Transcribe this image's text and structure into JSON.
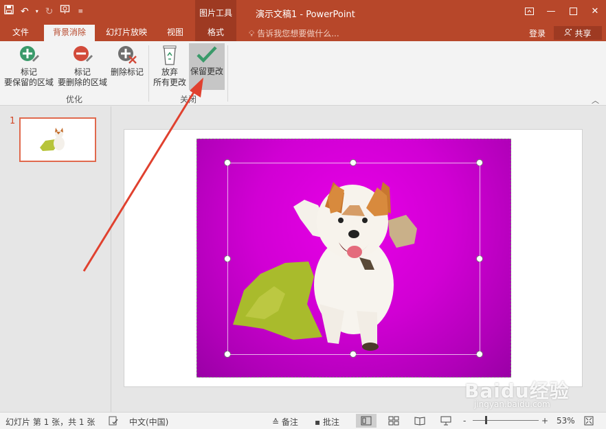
{
  "titlebar": {
    "context_tab_title": "图片工具",
    "document_title": "演示文稿1 - PowerPoint"
  },
  "tabs": [
    {
      "label": "文件"
    },
    {
      "label": "背景消除"
    },
    {
      "label": "幻灯片放映"
    },
    {
      "label": "视图"
    },
    {
      "label": "格式"
    }
  ],
  "tellme": {
    "placeholder": "告诉我您想要做什么..."
  },
  "account": {
    "login": "登录",
    "share": "共享"
  },
  "ribbon": {
    "btn_keep": {
      "line1": "标记",
      "line2": "要保留的区域"
    },
    "btn_remove": {
      "line1": "标记",
      "line2": "要删除的区域"
    },
    "btn_delete_mark": {
      "line1": "删除标记"
    },
    "group_refine": "优化",
    "btn_discard": {
      "line1": "放弃",
      "line2": "所有更改"
    },
    "btn_keep_changes": {
      "line1": "保留更改"
    },
    "group_close": "关闭"
  },
  "slides": {
    "current_number": "1"
  },
  "statusbar": {
    "slide_info": "幻灯片 第 1 张，共 1 张",
    "language": "中文(中国)",
    "notes": "备注",
    "comments": "批注",
    "zoom_minus": "-",
    "zoom_plus": "+",
    "zoom_level": "53%"
  },
  "watermark": {
    "brand": "Baidu经验",
    "url": "jingyan.baidu.com"
  },
  "colors": {
    "accent": "#b7472a",
    "background_removal_magenta": "#d100d4",
    "arrow": "#e0412f"
  }
}
